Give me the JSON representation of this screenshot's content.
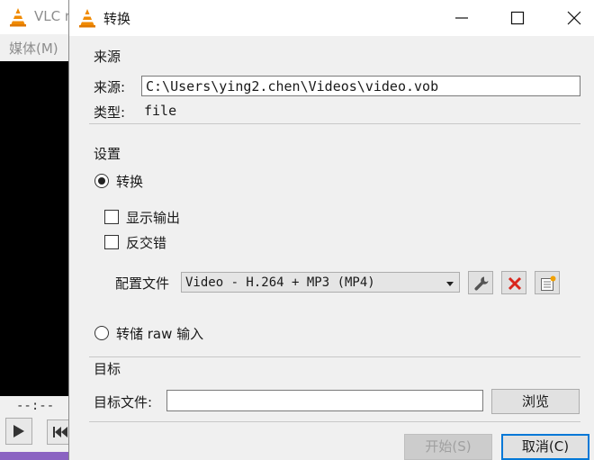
{
  "background_window": {
    "title": "VLC r",
    "menu_label": "媒体(M)",
    "time": "--:--"
  },
  "dialog": {
    "title": "转换",
    "source": {
      "section_title": "来源",
      "source_label": "来源:",
      "source_value": "C:\\Users\\ying2.chen\\Videos\\video.vob",
      "type_label": "类型:",
      "type_value": "file"
    },
    "settings": {
      "section_title": "设置",
      "convert_label": "转换",
      "convert_selected": true,
      "show_output_label": "显示输出",
      "show_output_checked": false,
      "deinterlace_label": "反交错",
      "deinterlace_checked": false,
      "profile_label": "配置文件",
      "profile_value": "Video - H.264 + MP3 (MP4)",
      "dump_raw_label": "转储 raw 输入",
      "dump_raw_selected": false
    },
    "destination": {
      "section_title": "目标",
      "file_label": "目标文件:",
      "file_value": "",
      "browse_label": "浏览"
    },
    "footer": {
      "start_label": "开始(S)",
      "cancel_label": "取消(C)"
    }
  },
  "colors": {
    "vlc_orange": "#f08a00",
    "delete_red": "#d9261c",
    "taskbar_purple": "#8b63c2"
  }
}
